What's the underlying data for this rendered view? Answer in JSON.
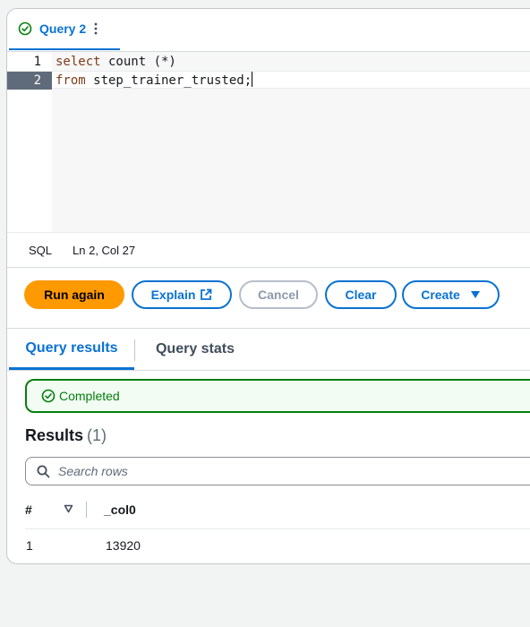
{
  "query_tab": {
    "label": "Query 2"
  },
  "editor": {
    "lines": [
      {
        "number": "1",
        "keyword": "select",
        "rest": " count (*)"
      },
      {
        "number": "2",
        "keyword": "from",
        "rest": " step_trainer_trusted;"
      }
    ]
  },
  "status_bar": {
    "language": "SQL",
    "position": "Ln 2, Col 27"
  },
  "toolbar": {
    "run_again": "Run again",
    "explain": "Explain",
    "cancel": "Cancel",
    "clear": "Clear",
    "create": "Create"
  },
  "result_tabs": {
    "results": "Query results",
    "stats": "Query stats"
  },
  "result_status": "Completed",
  "results": {
    "title": "Results",
    "count": "(1)",
    "search_placeholder": "Search rows",
    "columns": [
      "#",
      "_col0"
    ],
    "rows": [
      {
        "index": "1",
        "value": "13920"
      }
    ]
  },
  "colors": {
    "accent": "#0972d3",
    "primary_button": "#ff9900",
    "success": "#037f0c"
  }
}
